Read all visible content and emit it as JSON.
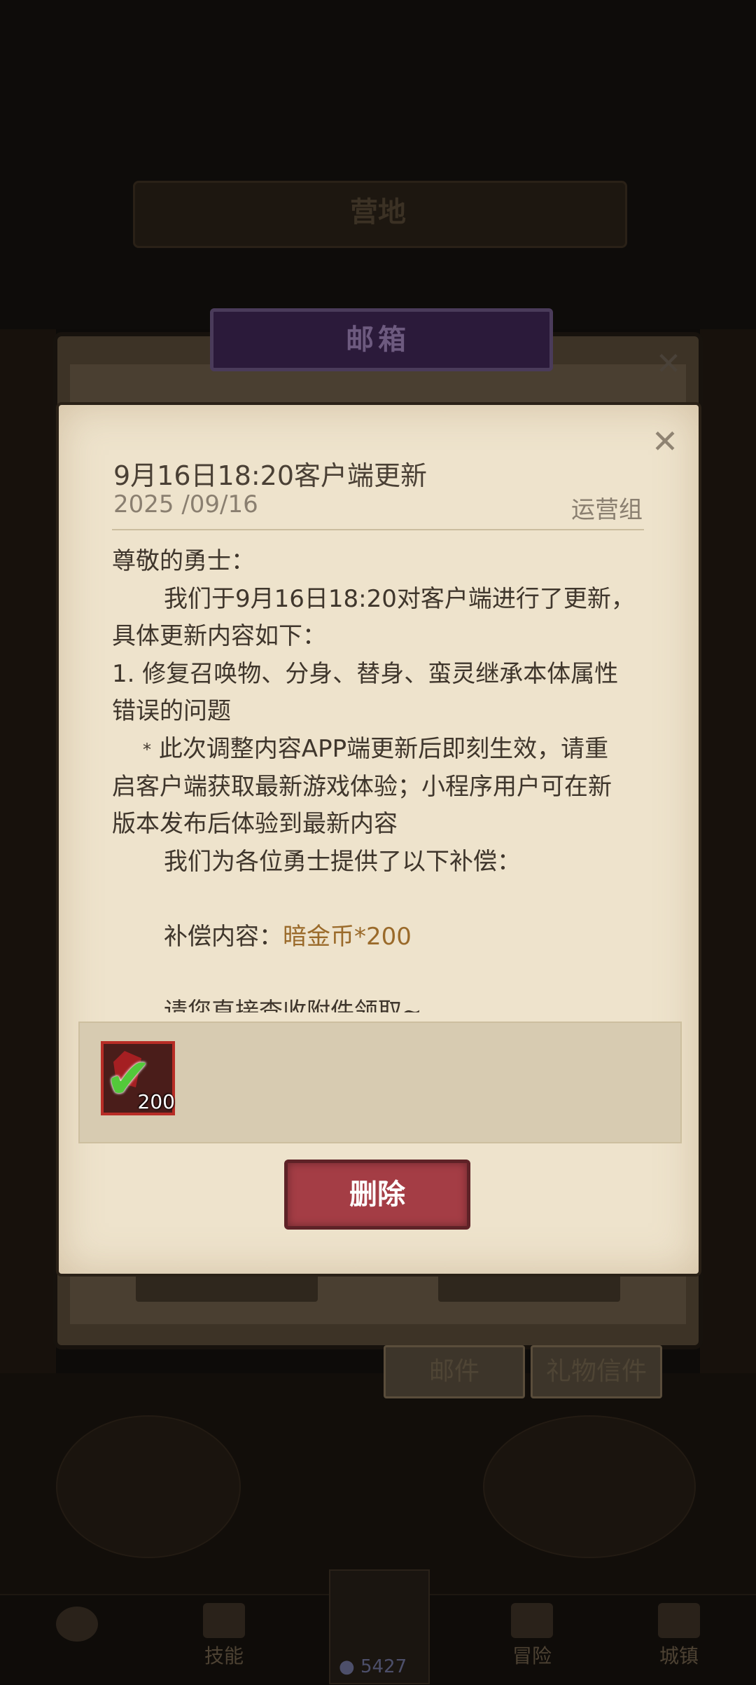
{
  "background": {
    "camp_title": "营地",
    "mailbox_title": "邮箱",
    "tabs": [
      "邮件",
      "礼物信件"
    ]
  },
  "mail": {
    "title": "9月16日18:20客户端更新",
    "date": "2025 /09/16",
    "sender": "运营组",
    "body": {
      "greeting": "尊敬的勇士：",
      "intro_1": "我们于9月16日18:20对客户端进行了更新，",
      "intro_2": "具体更新内容如下：",
      "fix_1": "1. 修复召唤物、分身、替身、蛮灵继承本体属性",
      "fix_2": "错误的问题",
      "star": "*",
      "note_1": "此次调整内容APP端更新后即刻生效，请重",
      "note_2": "启客户端获取最新游戏体验；小程序用户可在新",
      "note_3": "版本发布后体验到最新内容",
      "comp_intro": "我们为各位勇士提供了以下补偿：",
      "comp_label": "补偿内容：",
      "comp_value": "暗金币*200",
      "claim": "请您直接查收附件领取~"
    },
    "attachment": {
      "icon": "red-gem-icon",
      "quantity": "200",
      "claimed": true
    },
    "delete_label": "删除"
  },
  "nav": {
    "skills_label": "技能",
    "energy_value": "5427",
    "adventure_label": "冒险",
    "city_label": "城镇"
  },
  "colors": {
    "parchment": "#eee3cc",
    "delete_button": "#a43d45",
    "highlight_text": "#9a6a2a",
    "claimed_check": "#53c93a"
  }
}
